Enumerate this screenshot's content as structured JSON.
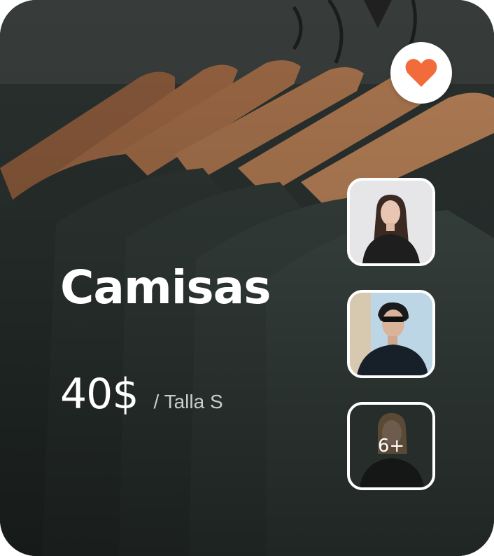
{
  "product": {
    "title": "Camisas",
    "price": "40$",
    "size_label": "/ Talla S"
  },
  "favorite": {
    "icon": "heart-icon",
    "color": "#f26b3a"
  },
  "gallery": {
    "more_label": "6+"
  },
  "colors": {
    "background": "#2a302e",
    "text_primary": "#ffffff",
    "text_secondary": "#c9cfcd",
    "accent": "#f26b3a"
  }
}
